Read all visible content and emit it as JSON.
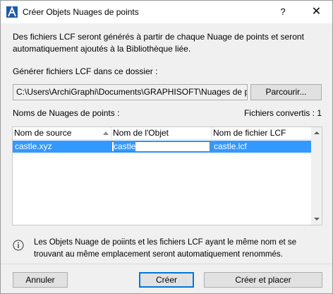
{
  "window": {
    "title": "Créer Objets Nuages de points",
    "help_label": "?",
    "close_label": "✕",
    "app_icon": "archicad-icon"
  },
  "description": {
    "line1": "Des fichiers LCF seront générés à partir de chaque Nuage de points et seront",
    "line2": "automatiquement ajoutés à la Bibliothèque liée."
  },
  "folder": {
    "label": "Générer fichiers LCF dans ce dossier :",
    "path": "C:\\Users\\ArchiGraphi\\Documents\\GRAPHISOFT\\Nuages de point",
    "browse_label": "Parcourir..."
  },
  "list": {
    "label": "Noms de Nuages de points :",
    "converted_label": "Fichiers convertis : 1",
    "columns": [
      "Nom de source",
      "Nom de l'Objet",
      "Nom de fichier LCF"
    ],
    "rows": [
      {
        "source": "castle.xyz",
        "object": "castle",
        "lcf": "castle.lcf"
      }
    ]
  },
  "info": {
    "icon": "info-icon",
    "line1": "Les Objets Nuage de poiints et les fichiers LCF ayant le même nom et se",
    "line2": "trouvant au même emplacement seront automatiquement renommés."
  },
  "footer": {
    "cancel_label": "Annuler",
    "create_label": "Créer",
    "create_place_label": "Créer et placer"
  },
  "colors": {
    "selection": "#3399ff",
    "default_button_border": "#0078d7",
    "dialog_background": "#f0f0f0"
  }
}
